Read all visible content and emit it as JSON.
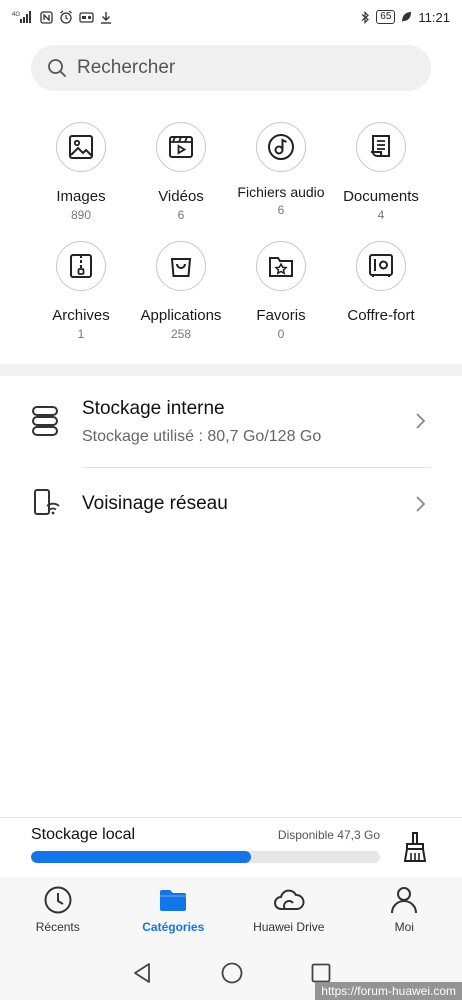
{
  "status_bar": {
    "network_label": "4G",
    "battery": "65",
    "time": "11:21",
    "icons": [
      "signal-icon",
      "nfc-icon",
      "alarm-icon",
      "radio-icon",
      "download-icon",
      "bluetooth-icon",
      "battery-icon",
      "leaf-icon"
    ]
  },
  "search": {
    "placeholder": "Rechercher",
    "icon": "search-icon"
  },
  "categories": [
    {
      "name": "Images",
      "count": "890",
      "icon": "image-icon"
    },
    {
      "name": "Vidéos",
      "count": "6",
      "icon": "video-icon"
    },
    {
      "name": "Fichiers audio",
      "count": "6",
      "icon": "audio-icon"
    },
    {
      "name": "Documents",
      "count": "4",
      "icon": "document-icon"
    },
    {
      "name": "Archives",
      "count": "1",
      "icon": "archive-icon"
    },
    {
      "name": "Applications",
      "count": "258",
      "icon": "applications-icon"
    },
    {
      "name": "Favoris",
      "count": "0",
      "icon": "favorites-icon"
    },
    {
      "name": "Coffre-fort",
      "count": "",
      "icon": "safe-icon"
    }
  ],
  "locations": [
    {
      "title": "Stockage interne",
      "subtitle": "Stockage utilisé : 80,7 Go/128 Go",
      "icon": "storage-icon"
    },
    {
      "title": "Voisinage réseau",
      "subtitle": "",
      "icon": "network-neighborhood-icon"
    }
  ],
  "storage": {
    "label": "Stockage local",
    "available": "Disponible 47,3 Go",
    "used_fraction": 0.63,
    "accent": "#1476e6"
  },
  "bottom_nav": [
    {
      "label": "Récents",
      "icon": "clock-icon",
      "active": false
    },
    {
      "label": "Catégories",
      "icon": "folder-icon",
      "active": true
    },
    {
      "label": "Huawei Drive",
      "icon": "cloud-icon",
      "active": false
    },
    {
      "label": "Moi",
      "icon": "person-icon",
      "active": false
    }
  ],
  "watermark": "https://forum-huawei.com"
}
